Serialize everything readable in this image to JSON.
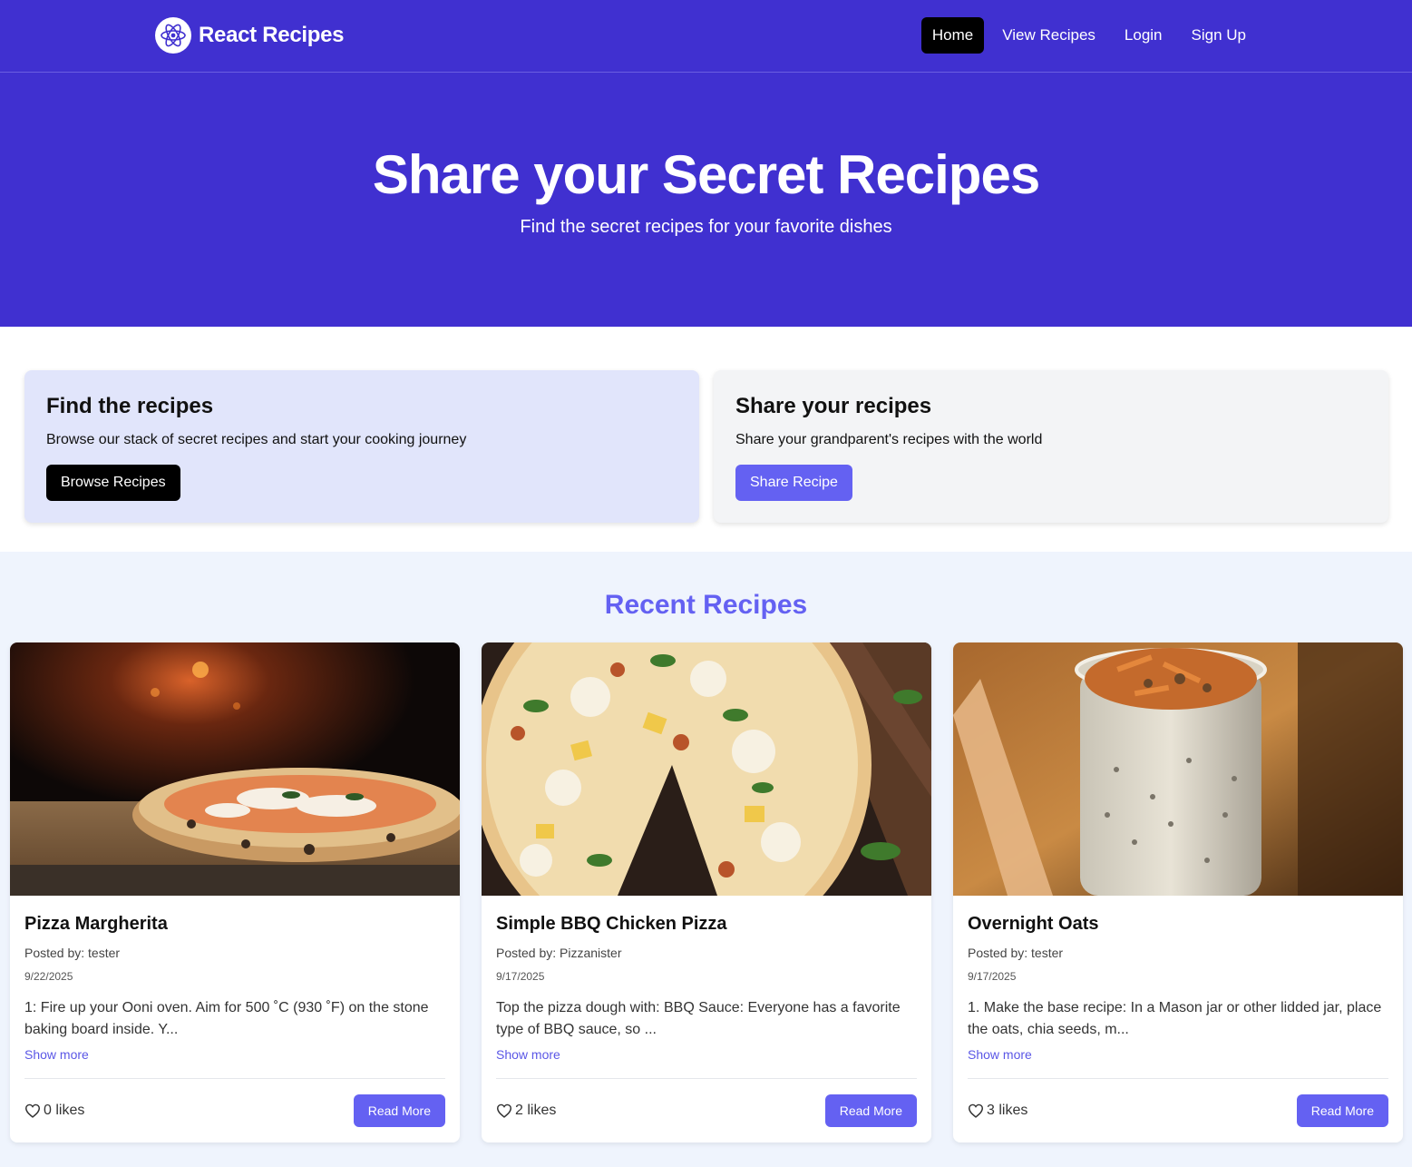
{
  "header": {
    "brand_name": "React Recipes",
    "nav": [
      "Home",
      "View Recipes",
      "Login",
      "Sign Up"
    ],
    "active_nav": "Home"
  },
  "hero": {
    "title": "Share your Secret Recipes",
    "subtitle": "Find the secret recipes for your favorite dishes"
  },
  "promos": {
    "find": {
      "title": "Find the recipes",
      "text": "Browse our stack of secret recipes and start your cooking journey",
      "button": "Browse Recipes"
    },
    "share": {
      "title": "Share your recipes",
      "text": "Share your grandparent's recipes with the world",
      "button": "Share Recipe"
    }
  },
  "recent": {
    "title": "Recent Recipes",
    "recipes": [
      {
        "title": "Pizza Margherita",
        "author": "Posted by: tester",
        "date": "9/22/2025",
        "description": "1: Fire up your Ooni oven.  Aim for 500 ˚C (930 ˚F) on the stone baking board inside. Y...",
        "show_more": "Show more",
        "likes": "0 likes",
        "read_more": "Read More",
        "image": "pizza-margherita-photo"
      },
      {
        "title": "Simple BBQ Chicken Pizza",
        "author": "Posted by: Pizzanister",
        "date": "9/17/2025",
        "description": "Top the pizza dough with:  BBQ Sauce: Everyone has a favorite type of BBQ sauce, so ...",
        "show_more": "Show more",
        "likes": "2 likes",
        "read_more": "Read More",
        "image": "bbq-chicken-pizza-photo"
      },
      {
        "title": "Overnight Oats",
        "author": "Posted by: tester",
        "date": "9/17/2025",
        "description": "1. Make the base recipe: In a Mason jar or other lidded jar, place the oats, chia seeds, m...",
        "show_more": "Show more",
        "likes": "3 likes",
        "read_more": "Read More",
        "image": "overnight-oats-photo"
      }
    ]
  },
  "colors": {
    "brand": "#4030d0",
    "accent": "#6461f2",
    "find_card_bg": "#e1e5fb",
    "share_card_bg": "#f3f4f6",
    "recent_bg": "#eff4fd"
  }
}
